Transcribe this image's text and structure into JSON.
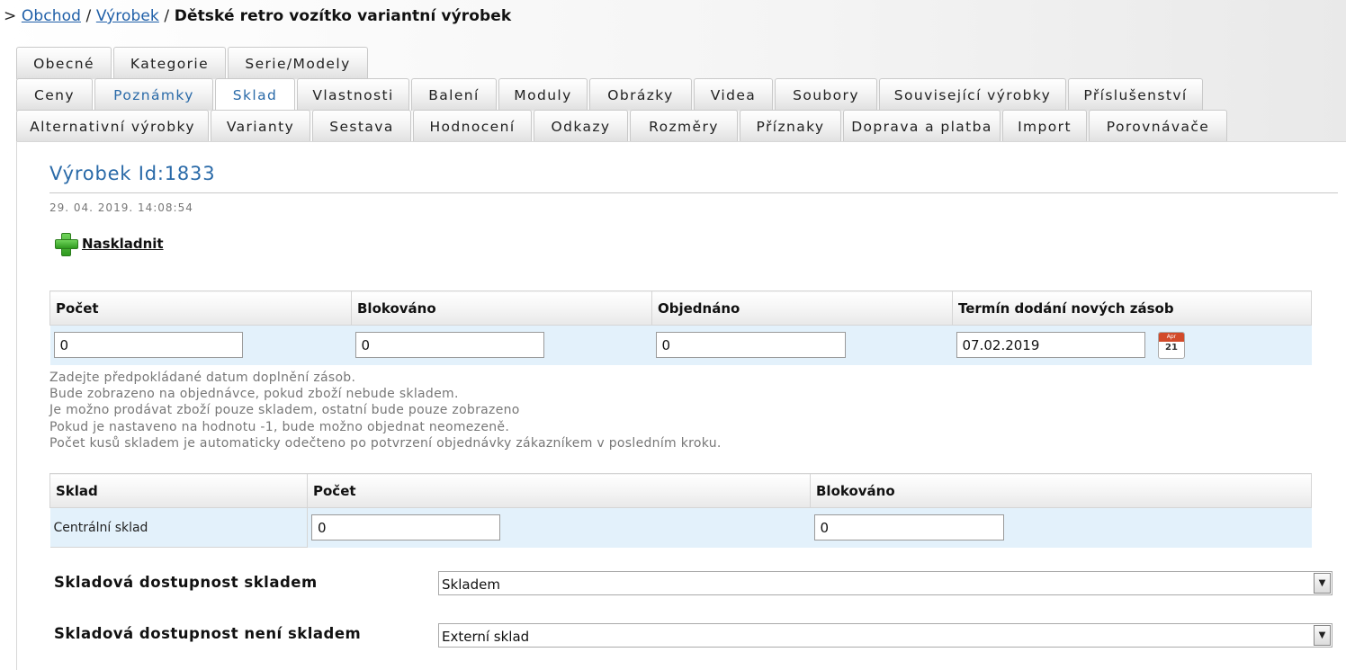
{
  "breadcrumb": {
    "prefix": ">",
    "items": [
      "Obchod",
      "Výrobek"
    ],
    "separator": "/",
    "current": "Dětské retro vozítko variantní výrobek"
  },
  "tabs": {
    "row1": [
      "Obecné",
      "Kategorie",
      "Serie/Modely"
    ],
    "row2": [
      "Ceny",
      "Poznámky",
      "Sklad",
      "Vlastnosti",
      "Balení",
      "Moduly",
      "Obrázky",
      "Videa",
      "Soubory",
      "Související výrobky",
      "Příslušenství"
    ],
    "row3": [
      "Alternativní výrobky",
      "Varianty",
      "Sestava",
      "Hodnocení",
      "Odkazy",
      "Rozměry",
      "Příznaky",
      "Doprava a platba",
      "Import",
      "Porovnávače"
    ],
    "active": "Sklad"
  },
  "product": {
    "title": "Výrobek Id:1833",
    "date": "29. 04. 2019. 14:08:54",
    "stock_link": "Naskladnit"
  },
  "stock_table": {
    "headers": [
      "Počet",
      "Blokováno",
      "Objednáno",
      "Termín dodání nových zásob"
    ],
    "values": [
      "0",
      "0",
      "0",
      "07.02.2019"
    ],
    "calendar": {
      "month": "Apr",
      "day": "21"
    }
  },
  "help_lines": [
    "Zadejte předpokládané datum doplnění zásob.",
    "Bude zobrazeno na objednávce, pokud zboží nebude skladem.",
    "Je možno prodávat zboží pouze skladem, ostatní bude pouze zobrazeno",
    "Pokud je nastaveno na hodnotu -1, bude možno objednat neomezeně.",
    "Počet kusů skladem je automaticky odečteno po potvrzení objednávky zákazníkem v posledním kroku."
  ],
  "warehouse_table": {
    "headers": [
      "Sklad",
      "Počet",
      "Blokováno"
    ],
    "rows": [
      {
        "name": "Centrální sklad",
        "count": "0",
        "blocked": "0"
      }
    ]
  },
  "availability": {
    "in_stock_label": "Skladová dostupnost skladem",
    "in_stock_value": "Skladem",
    "out_of_stock_label": "Skladová dostupnost není skladem",
    "out_of_stock_value": "Externí sklad"
  }
}
